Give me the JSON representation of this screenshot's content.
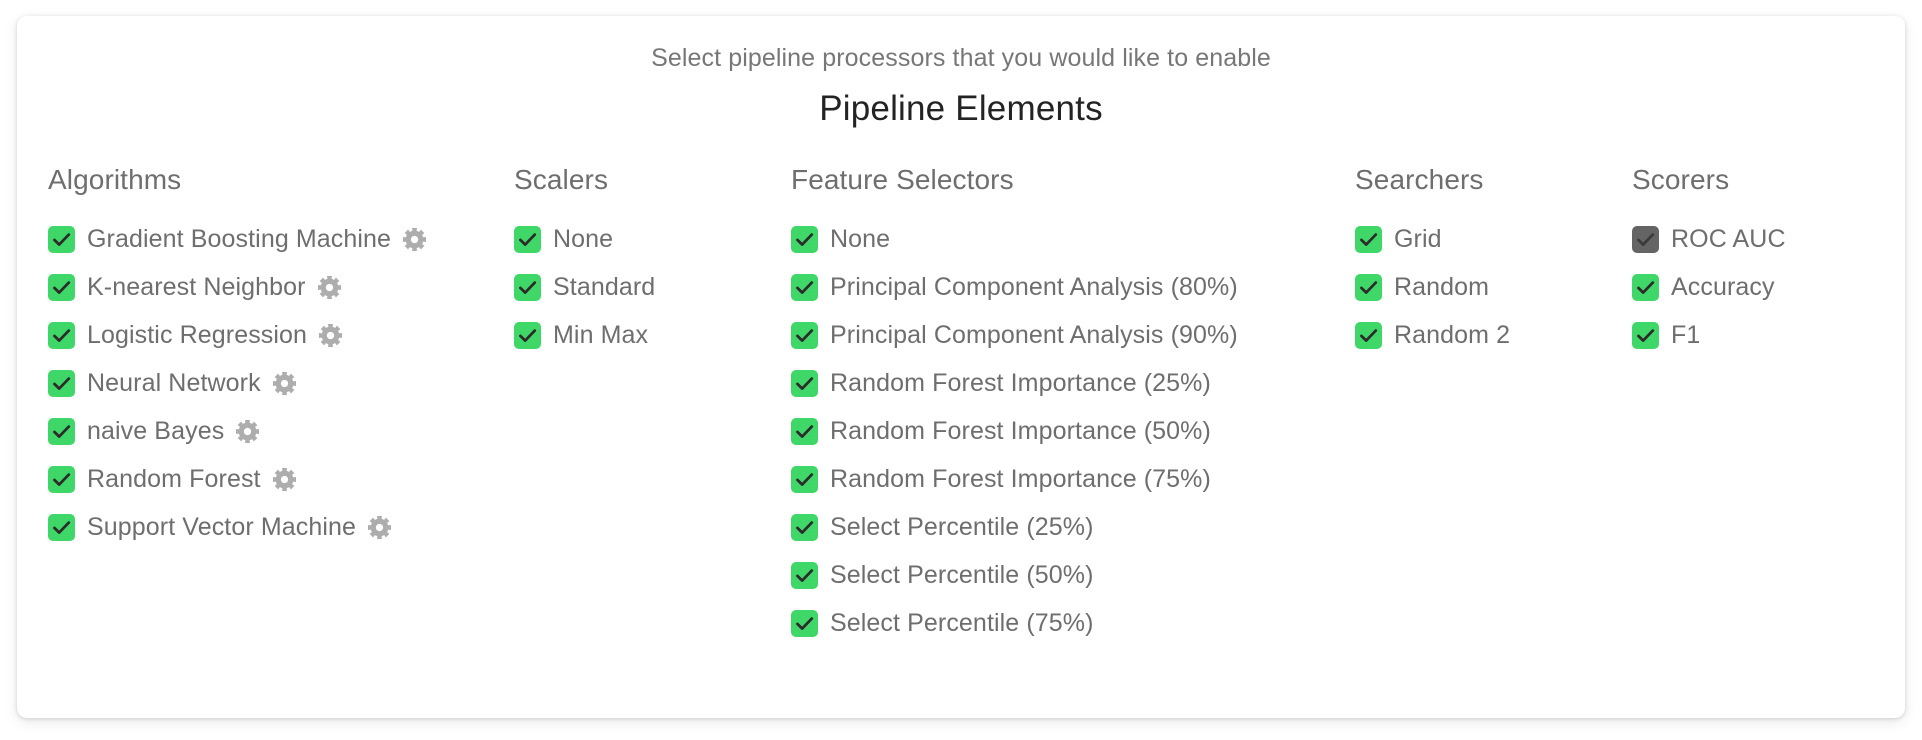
{
  "header": {
    "subtitle": "Select pipeline processors that you would like to enable",
    "title": "Pipeline Elements"
  },
  "colors": {
    "checkbox_checked": "#3ed768",
    "checkbox_disabled": "#646464",
    "checkmark": "#2b2b2b",
    "label_text": "#6e6e6e",
    "title_text": "#232323",
    "subtitle_text": "#777777",
    "gear_icon": "#adadad",
    "card_background": "#ffffff"
  },
  "icons": {
    "gear": "gear-icon",
    "check": "check-icon"
  },
  "columns": [
    {
      "key": "algorithms",
      "title": "Algorithms",
      "items": [
        {
          "label": "Gradient Boosting Machine",
          "checked": true,
          "gear": true
        },
        {
          "label": "K-nearest Neighbor",
          "checked": true,
          "gear": true
        },
        {
          "label": "Logistic Regression",
          "checked": true,
          "gear": true
        },
        {
          "label": "Neural Network",
          "checked": true,
          "gear": true
        },
        {
          "label": "naive Bayes",
          "checked": true,
          "gear": true
        },
        {
          "label": "Random Forest",
          "checked": true,
          "gear": true
        },
        {
          "label": "Support Vector Machine",
          "checked": true,
          "gear": true
        }
      ]
    },
    {
      "key": "scalers",
      "title": "Scalers",
      "items": [
        {
          "label": "None",
          "checked": true,
          "gear": false
        },
        {
          "label": "Standard",
          "checked": true,
          "gear": false
        },
        {
          "label": "Min Max",
          "checked": true,
          "gear": false
        }
      ]
    },
    {
      "key": "feature_selectors",
      "title": "Feature Selectors",
      "items": [
        {
          "label": "None",
          "checked": true,
          "gear": false
        },
        {
          "label": "Principal Component Analysis (80%)",
          "checked": true,
          "gear": false
        },
        {
          "label": "Principal Component Analysis (90%)",
          "checked": true,
          "gear": false
        },
        {
          "label": "Random Forest Importance (25%)",
          "checked": true,
          "gear": false
        },
        {
          "label": "Random Forest Importance (50%)",
          "checked": true,
          "gear": false
        },
        {
          "label": "Random Forest Importance (75%)",
          "checked": true,
          "gear": false
        },
        {
          "label": "Select Percentile (25%)",
          "checked": true,
          "gear": false
        },
        {
          "label": "Select Percentile (50%)",
          "checked": true,
          "gear": false
        },
        {
          "label": "Select Percentile (75%)",
          "checked": true,
          "gear": false
        }
      ]
    },
    {
      "key": "searchers",
      "title": "Searchers",
      "items": [
        {
          "label": "Grid",
          "checked": true,
          "gear": false
        },
        {
          "label": "Random",
          "checked": true,
          "gear": false
        },
        {
          "label": "Random 2",
          "checked": true,
          "gear": false
        }
      ]
    },
    {
      "key": "scorers",
      "title": "Scorers",
      "items": [
        {
          "label": "ROC AUC",
          "checked": true,
          "disabled": true,
          "gear": false
        },
        {
          "label": "Accuracy",
          "checked": true,
          "gear": false
        },
        {
          "label": "F1",
          "checked": true,
          "gear": false
        }
      ]
    }
  ]
}
